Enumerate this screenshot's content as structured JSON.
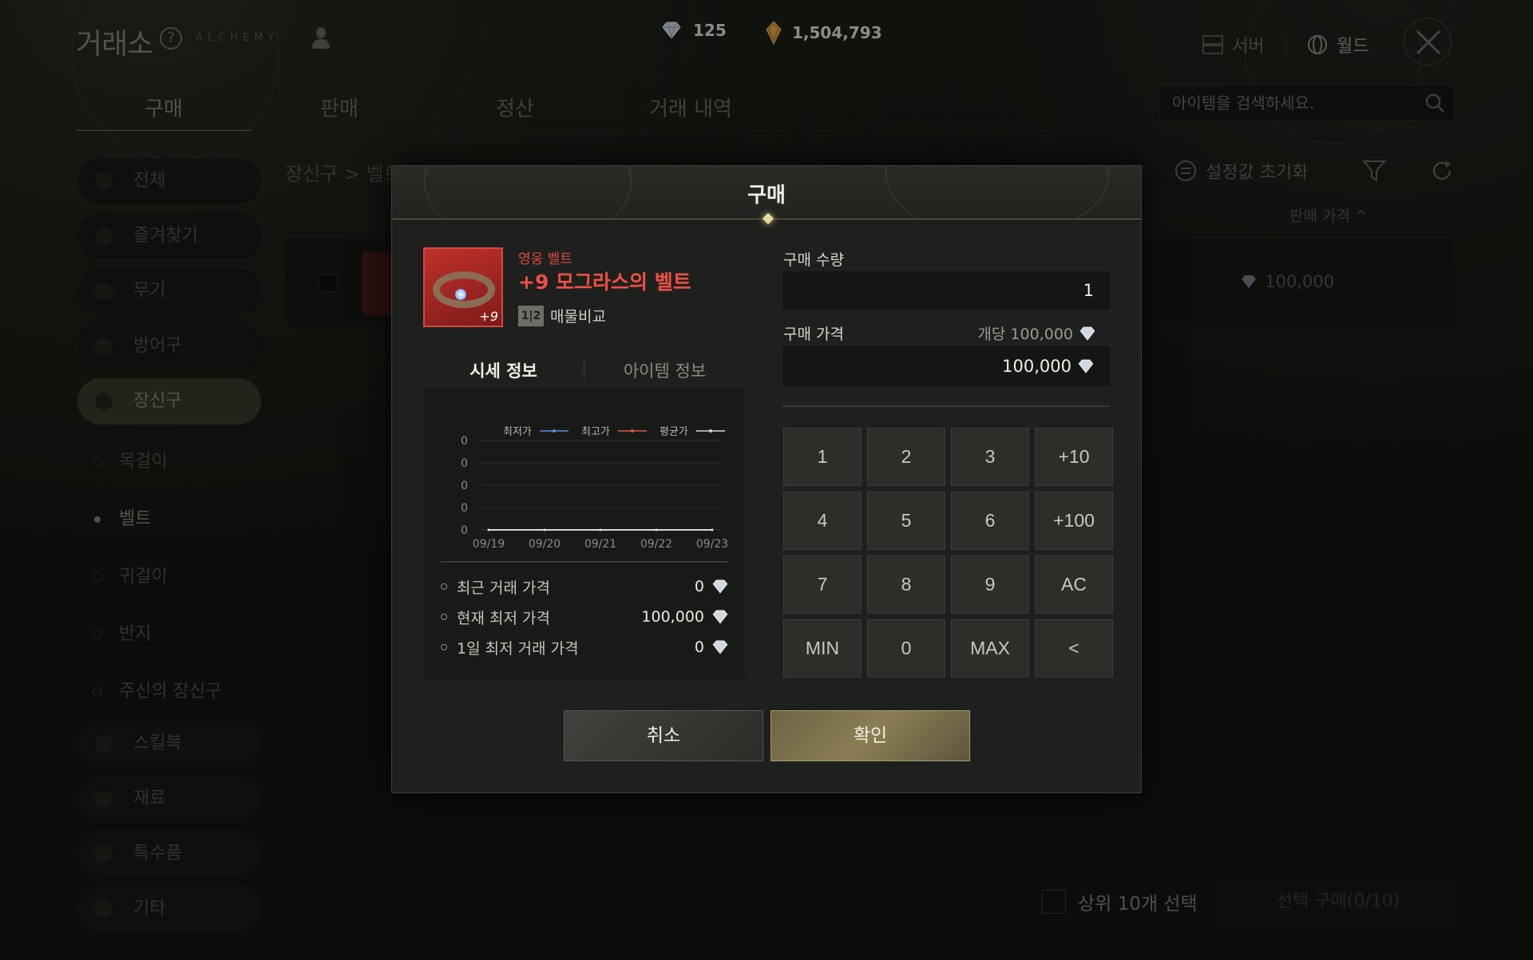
{
  "app": {
    "title": "거래소",
    "help": "?",
    "alchemy": "ALCHEMY"
  },
  "currency": {
    "gem_value": "125",
    "gold_value": "1,504,793"
  },
  "top_right": {
    "server": "서버",
    "world": "월드"
  },
  "nav": {
    "tabs": [
      "구매",
      "판매",
      "정산",
      "거래 내역"
    ]
  },
  "search": {
    "placeholder": "아이템을 검색하세요."
  },
  "sidebar": {
    "items": [
      "전체",
      "즐겨찾기",
      "무기",
      "방어구",
      "장신구"
    ],
    "sub_items": [
      "목걸이",
      "벨트",
      "귀걸이",
      "반지",
      "주신의 장신구"
    ],
    "items_bottom": [
      "스킬북",
      "재료",
      "특수품",
      "기타"
    ]
  },
  "breadcrumb": "장신구  >  벨트  >",
  "toolbar": {
    "reset": "설정값 초기화"
  },
  "list": {
    "sort_header": "판매 가격 ^",
    "row_price": "100,000"
  },
  "footer": {
    "select_top10": "상위 10개 선택",
    "buy_selected": "선택 구매(0/10)"
  },
  "modal": {
    "title": "구매",
    "item": {
      "grade": "영웅 벨트",
      "name": "+9 모그라스의 벨트",
      "enhance": "+9",
      "compare_icon": "1|2",
      "compare_label": "매물비교"
    },
    "tabs": {
      "market": "시세 정보",
      "item": "아이템 정보"
    },
    "stats": [
      {
        "label": "최근 거래 가격",
        "value": "0"
      },
      {
        "label": "현재 최저 가격",
        "value": "100,000"
      },
      {
        "label": "1일 최저 거래 가격",
        "value": "0"
      }
    ],
    "quantity": {
      "label": "구매 수량",
      "value": "1"
    },
    "price": {
      "label": "구매 가격",
      "unit_label": "개당 100,000",
      "total": "100,000"
    },
    "keypad": [
      "1",
      "2",
      "3",
      "+10",
      "4",
      "5",
      "6",
      "+100",
      "7",
      "8",
      "9",
      "AC",
      "MIN",
      "0",
      "MAX",
      "<"
    ],
    "buttons": {
      "cancel": "취소",
      "confirm": "확인"
    }
  },
  "chart_data": {
    "type": "line",
    "categories": [
      "09/19",
      "09/20",
      "09/21",
      "09/22",
      "09/23"
    ],
    "y_ticks": [
      "0",
      "0",
      "0",
      "0",
      "0"
    ],
    "series": [
      {
        "name": "최저가",
        "color": "#5b8fd6",
        "values": [
          0,
          0,
          0,
          0,
          0
        ]
      },
      {
        "name": "최고가",
        "color": "#d65b45",
        "values": [
          0,
          0,
          0,
          0,
          0
        ]
      },
      {
        "name": "평균가",
        "color": "#d8d8d0",
        "values": [
          0,
          0,
          0,
          0,
          0
        ]
      }
    ],
    "ylim": [
      0,
      0
    ],
    "grid": true,
    "legend": "top"
  },
  "icons": {
    "gem": "diamond-icon",
    "gold": "gold-crystal-icon",
    "close": "close-icon",
    "search": "search-icon"
  }
}
